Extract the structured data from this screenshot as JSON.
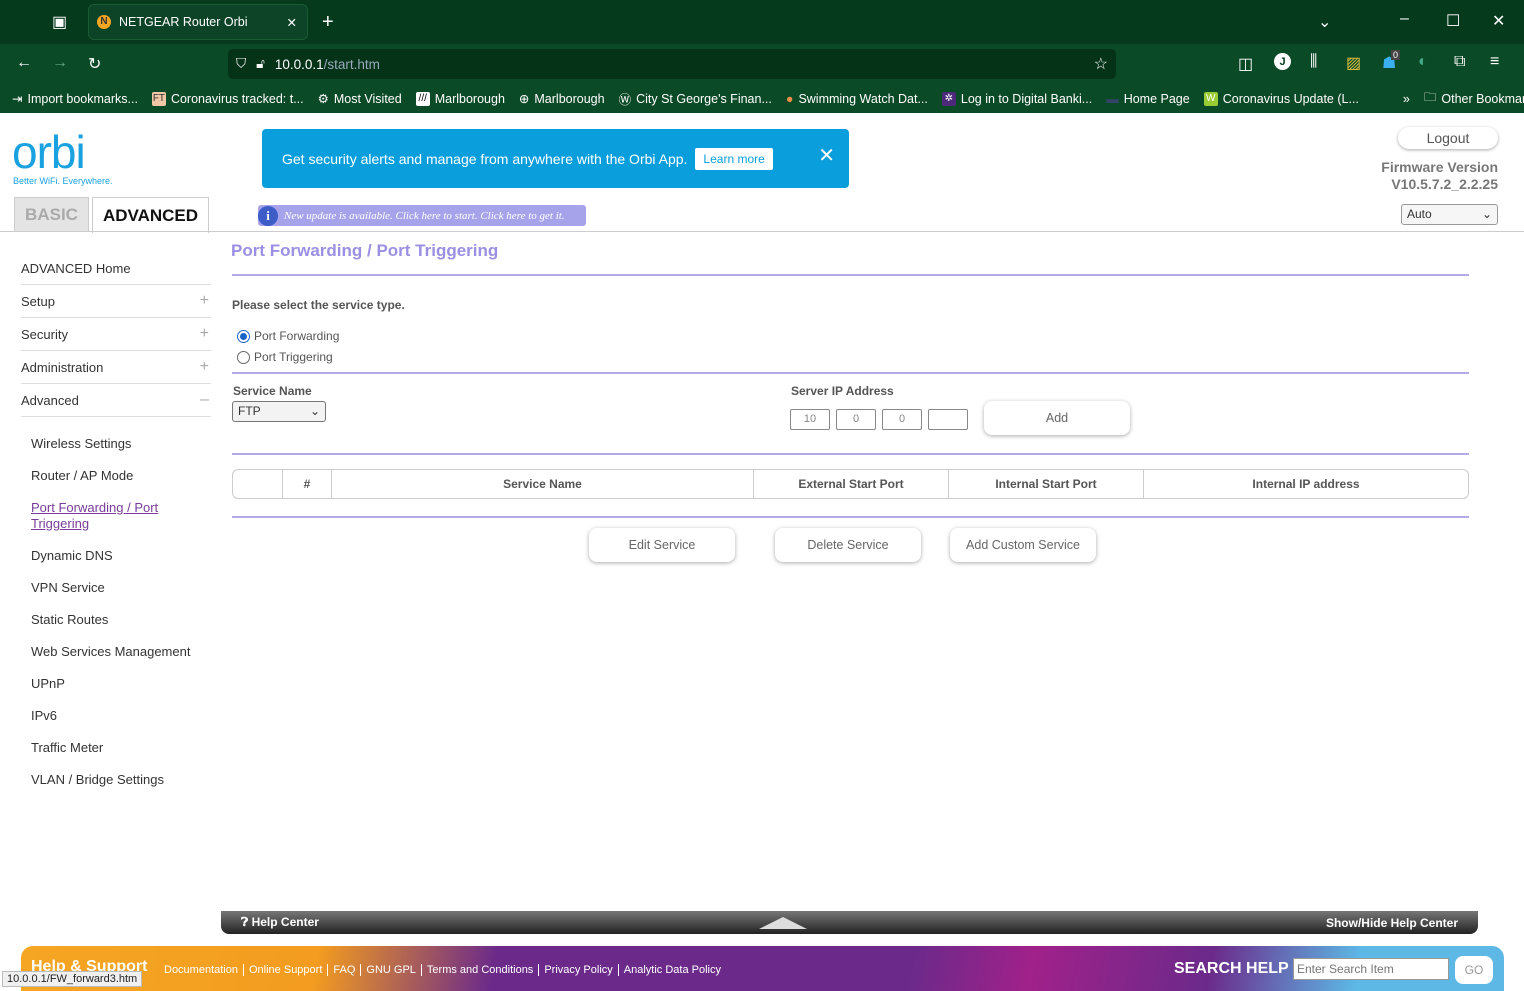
{
  "browser": {
    "tab_title": "NETGEAR Router Orbi",
    "url_host": "10.0.0.1",
    "url_path": "/start.htm",
    "bookmarks": [
      "Import bookmarks...",
      "Coronavirus tracked: t...",
      "Most Visited",
      "Marlborough",
      "Marlborough",
      "City St George's Finan...",
      "Swimming Watch Dat...",
      "Log in to Digital Banki...",
      "Home Page",
      "Coronavirus Update (L..."
    ],
    "other_bookmarks": "Other Bookmarks",
    "badge_count": "0",
    "status_url": "10.0.0.1/FW_forward3.htm"
  },
  "header": {
    "logo": "orbi",
    "tagline": "Better WiFi. Everywhere.",
    "banner_text": "Get security alerts and manage from anywhere with the Orbi App.",
    "learn_more": "Learn more",
    "tab_basic": "BASIC",
    "tab_advanced": "ADVANCED",
    "update_notice": "New update is available. Click here to start. Click here to get it.",
    "logout": "Logout",
    "firmware_label": "Firmware Version",
    "firmware_version": "V10.5.7.2_2.2.25",
    "language": "Auto"
  },
  "sidebar": {
    "sections": [
      "ADVANCED Home",
      "Setup",
      "Security",
      "Administration",
      "Advanced"
    ],
    "items": [
      "Wireless Settings",
      "Router / AP Mode",
      "Port Forwarding / Port Triggering",
      "Dynamic DNS",
      "VPN Service",
      "Static Routes",
      "Web Services Management",
      "UPnP",
      "IPv6",
      "Traffic Meter",
      "VLAN / Bridge Settings"
    ]
  },
  "main": {
    "title": "Port Forwarding / Port Triggering",
    "service_type_label": "Please select the service type.",
    "radio_forwarding": "Port Forwarding",
    "radio_triggering": "Port Triggering",
    "service_name_label": "Service Name",
    "service_name_value": "FTP",
    "server_ip_label": "Server IP Address",
    "ip": [
      "10",
      "0",
      "0",
      ""
    ],
    "add": "Add",
    "columns": [
      "",
      "#",
      "Service Name",
      "External Start Port",
      "Internal Start Port",
      "Internal IP address"
    ],
    "edit": "Edit Service",
    "delete": "Delete Service",
    "add_custom": "Add Custom Service"
  },
  "footer": {
    "help_center": "Help Center",
    "show_hide": "Show/Hide Help Center",
    "help_support": "Help & Support",
    "links": [
      "Documentation",
      "Online Support",
      "FAQ",
      "GNU GPL",
      "Terms and Conditions",
      "Privacy Policy",
      "Analytic Data Policy"
    ],
    "search_label": "SEARCH HELP",
    "search_placeholder": "Enter Search Item",
    "go": "GO"
  }
}
